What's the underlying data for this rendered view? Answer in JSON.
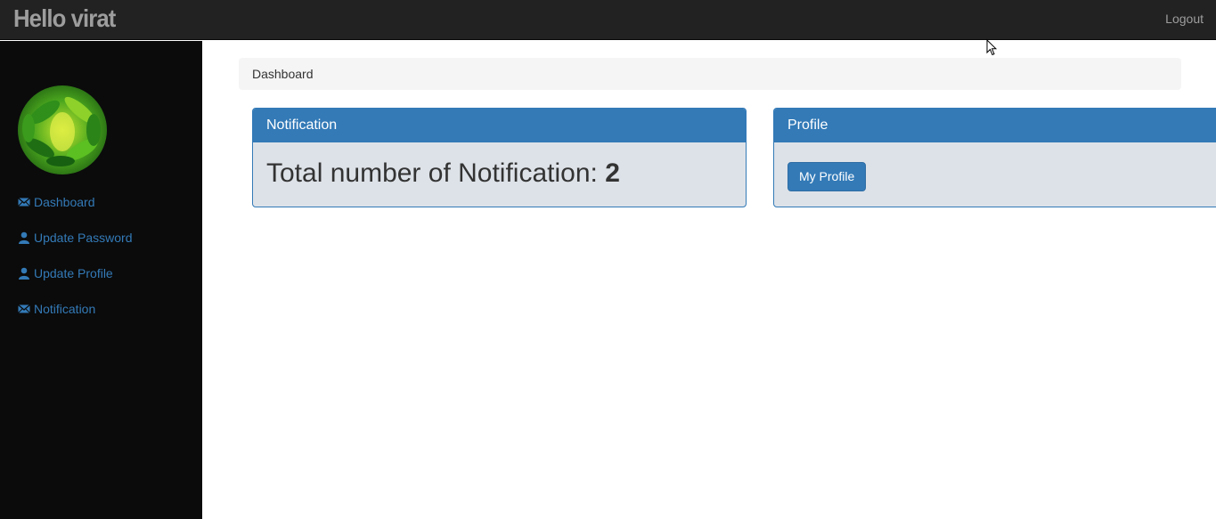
{
  "header": {
    "brand": "Hello virat",
    "logout_label": "Logout"
  },
  "sidebar": {
    "avatar_icon": "avatar-image",
    "items": [
      {
        "label": "Dashboard",
        "icon": "envelope-icon"
      },
      {
        "label": "Update Password",
        "icon": "user-icon"
      },
      {
        "label": "Update Profile",
        "icon": "user-icon"
      },
      {
        "label": "Notification",
        "icon": "envelope-icon"
      }
    ]
  },
  "breadcrumb": {
    "label": "Dashboard"
  },
  "notification_panel": {
    "title": "Notification",
    "count_label": "Total number of Notification: ",
    "count_value": "2"
  },
  "profile_panel": {
    "title": "Profile",
    "button_label": "My Profile"
  },
  "colors": {
    "topbar": "#222222",
    "sidebar": "#0b0b0b",
    "accent": "#337ab7",
    "panel_body": "#dde2e8"
  }
}
